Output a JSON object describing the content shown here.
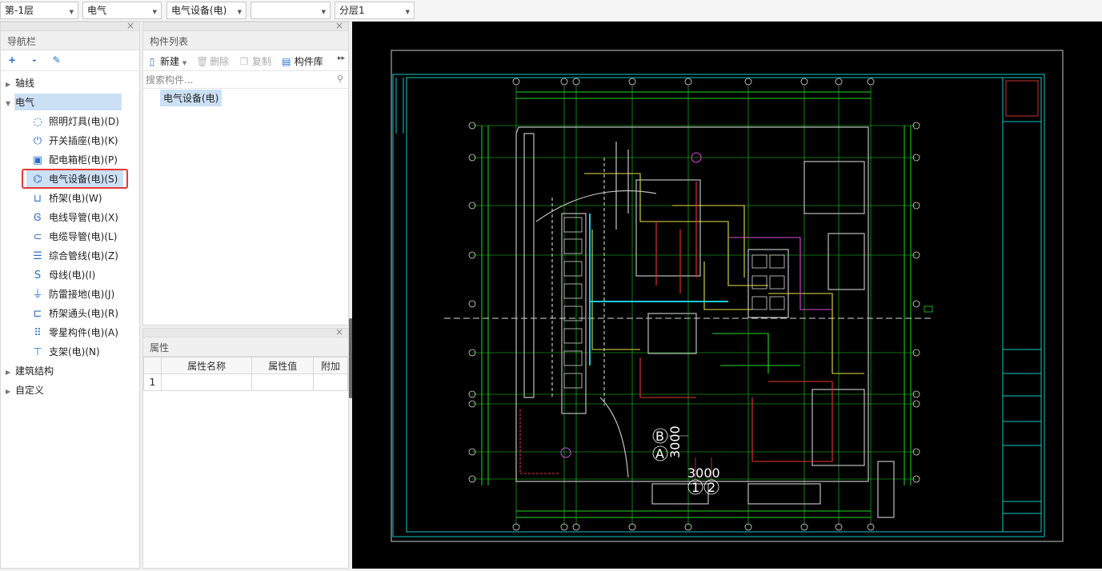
{
  "topbar": {
    "floor": "第-1层",
    "discipline": "电气",
    "category": "电气设备(电)",
    "component": "",
    "layer": "分层1"
  },
  "nav": {
    "title": "导航栏",
    "tools": [
      "+",
      "-",
      "✎"
    ],
    "items": [
      {
        "label": "轴线",
        "icon": "axis-icon"
      },
      {
        "label": "电气",
        "icon": "electric-icon"
      },
      {
        "label": "照明灯具(电)(D)",
        "icon": "lightbulb-icon"
      },
      {
        "label": "开关插座(电)(K)",
        "icon": "switch-icon"
      },
      {
        "label": "配电箱柜(电)(P)",
        "icon": "panel-box-icon"
      },
      {
        "label": "电气设备(电)(S)",
        "icon": "plug-icon"
      },
      {
        "label": "桥架(电)(W)",
        "icon": "tray-icon"
      },
      {
        "label": "电线导管(电)(X)",
        "icon": "wire-conduit-icon"
      },
      {
        "label": "电缆导管(电)(L)",
        "icon": "cable-conduit-icon"
      },
      {
        "label": "综合管线(电)(Z)",
        "icon": "combined-pipe-icon"
      },
      {
        "label": "母线(电)(I)",
        "icon": "busbar-icon"
      },
      {
        "label": "防雷接地(电)(J)",
        "icon": "grounding-icon"
      },
      {
        "label": "桥架通头(电)(R)",
        "icon": "tray-fitting-icon"
      },
      {
        "label": "零星构件(电)(A)",
        "icon": "grid-icon"
      },
      {
        "label": "支架(电)(N)",
        "icon": "bracket-icon"
      },
      {
        "label": "建筑结构",
        "icon": "building-icon"
      },
      {
        "label": "自定义",
        "icon": "custom-icon"
      }
    ]
  },
  "component_list": {
    "title": "构件列表",
    "new_label": "新建",
    "delete_label": "删除",
    "copy_label": "复制",
    "library_label": "构件库",
    "search_placeholder": "搜索构件...",
    "selected_item": "电气设备(电)"
  },
  "properties": {
    "title": "属性",
    "col_name": "属性名称",
    "col_value": "属性值",
    "col_extra": "附加",
    "row_index": "1"
  },
  "canvas": {
    "axis_letter_b": "B",
    "axis_letter_a": "A",
    "dim_vertical": "3000",
    "dim_horizontal": "3000",
    "axis_num_1": "1",
    "axis_num_2": "2"
  },
  "colors": {
    "accent": "#2a6fc9",
    "selection": "#cce0f5",
    "highlight_border": "#e53935",
    "cad_background": "#000000"
  }
}
